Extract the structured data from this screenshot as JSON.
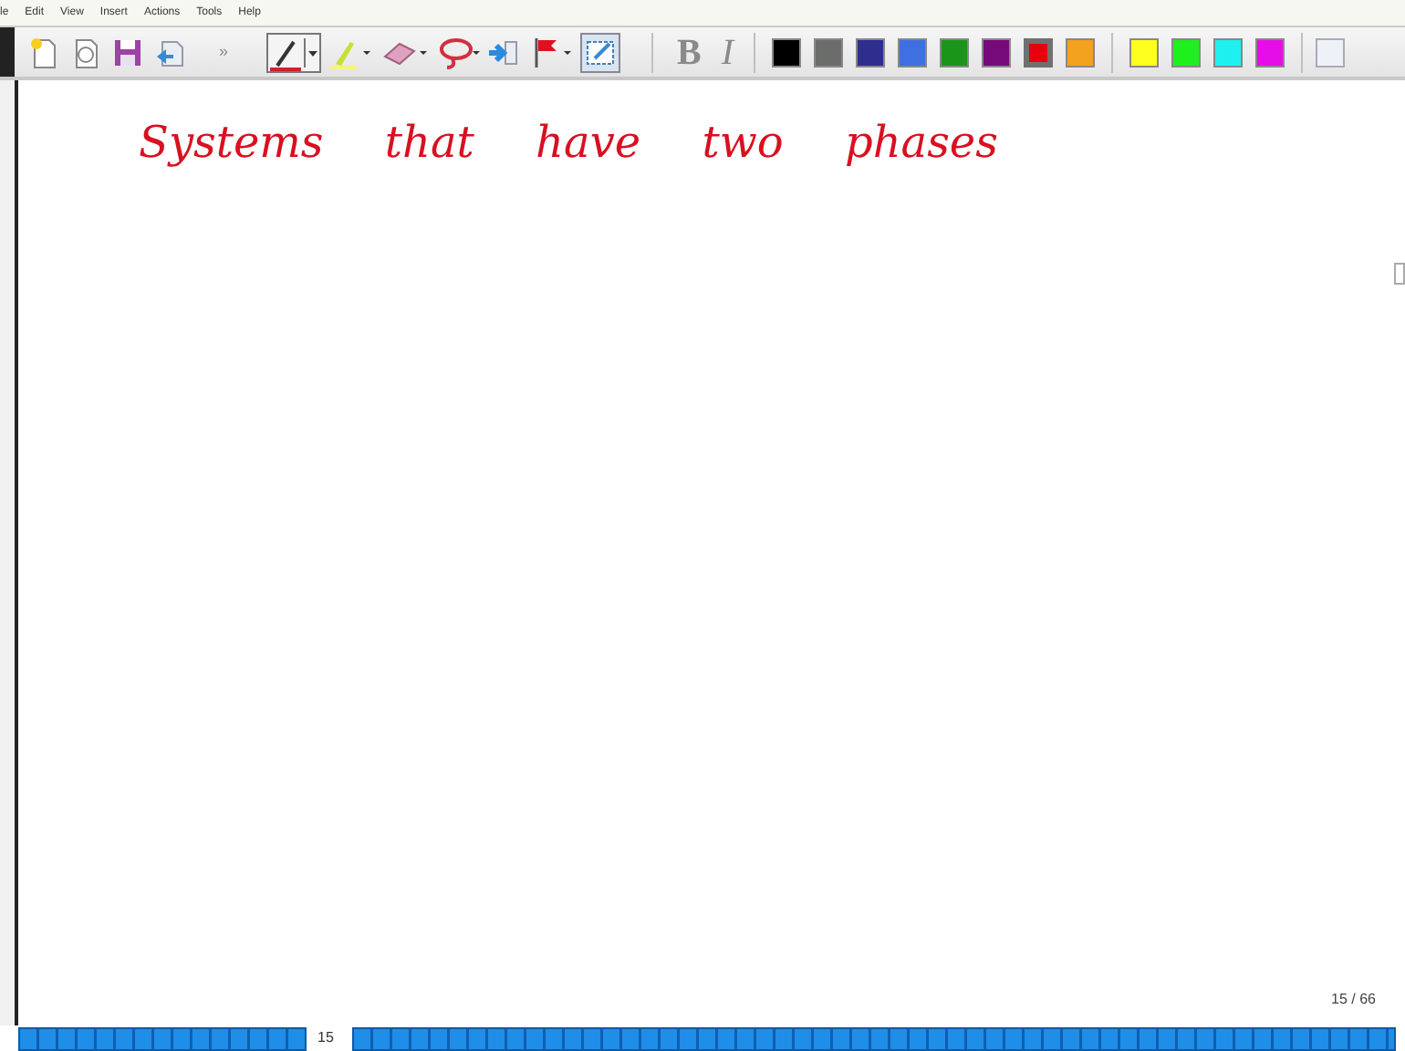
{
  "menu": [
    {
      "label": "le"
    },
    {
      "label": "Edit"
    },
    {
      "label": "View"
    },
    {
      "label": "Insert"
    },
    {
      "label": "Actions"
    },
    {
      "label": "Tools"
    },
    {
      "label": "Help"
    }
  ],
  "toolbar": {
    "overflow": "»",
    "bold": {
      "label": "B",
      "disabled": true
    },
    "italic": {
      "label": "I",
      "disabled": true
    }
  },
  "palette": [
    {
      "color": "#000000",
      "selected": false
    },
    {
      "color": "#6b6d6b",
      "selected": false
    },
    {
      "color": "#2e2e8c",
      "selected": false
    },
    {
      "color": "#3f6fe0",
      "selected": false
    },
    {
      "color": "#1a951a",
      "selected": false
    },
    {
      "color": "#760a7a",
      "selected": false
    },
    {
      "color": "#e8000f",
      "selected": true
    },
    {
      "color": "#f2a21e",
      "selected": false
    },
    {
      "color": "#ffff1e",
      "selected": false
    },
    {
      "color": "#1ef01e",
      "selected": false
    },
    {
      "color": "#1ef0f0",
      "selected": false
    },
    {
      "color": "#e60ee6",
      "selected": false
    }
  ],
  "note": {
    "text": "Systems that have two phases"
  },
  "page_indicator": "15 / 66",
  "page_strip": {
    "current": "15"
  }
}
